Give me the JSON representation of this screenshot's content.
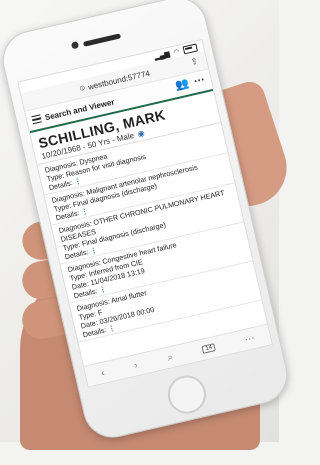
{
  "browser": {
    "url": "westbound:57774",
    "share_icon": "share-icon",
    "lock_icon": "lock-icon",
    "tab_count": "14"
  },
  "app": {
    "title": "Search and Viewer"
  },
  "patient": {
    "name": "SCHILLING, MARK",
    "dob_line": "10/20/1968 - 50 Yrs - Male"
  },
  "diagnoses": [
    {
      "diagnosis": "Diagnosis: Dyspnea",
      "type": "Type: Reason for visit diagnosis",
      "details": "Details:"
    },
    {
      "diagnosis": "Diagnosis: Malignant arteriolar nephrosclerosis",
      "type": "Type: Final diagnosis (discharge)",
      "details": "Details:"
    },
    {
      "diagnosis": "Diagnosis: OTHER CHRONIC PULMONARY HEART DISEASES",
      "type": "Type: Final diagnosis (discharge)",
      "details": "Details:"
    },
    {
      "diagnosis": "Diagnosis: Congestive heart failure",
      "type": "Type: Inferred from CIE",
      "date": "Date: 11/04/2018 13:19",
      "details": "Details:"
    },
    {
      "diagnosis": "Diagnosis: Atrial flutter",
      "type": "Type: F",
      "date": "Date: 03/26/2018 00:00",
      "details": "Details:"
    }
  ],
  "colors": {
    "accent": "#1f6b4a",
    "tree_icon": "#2e8b57"
  }
}
